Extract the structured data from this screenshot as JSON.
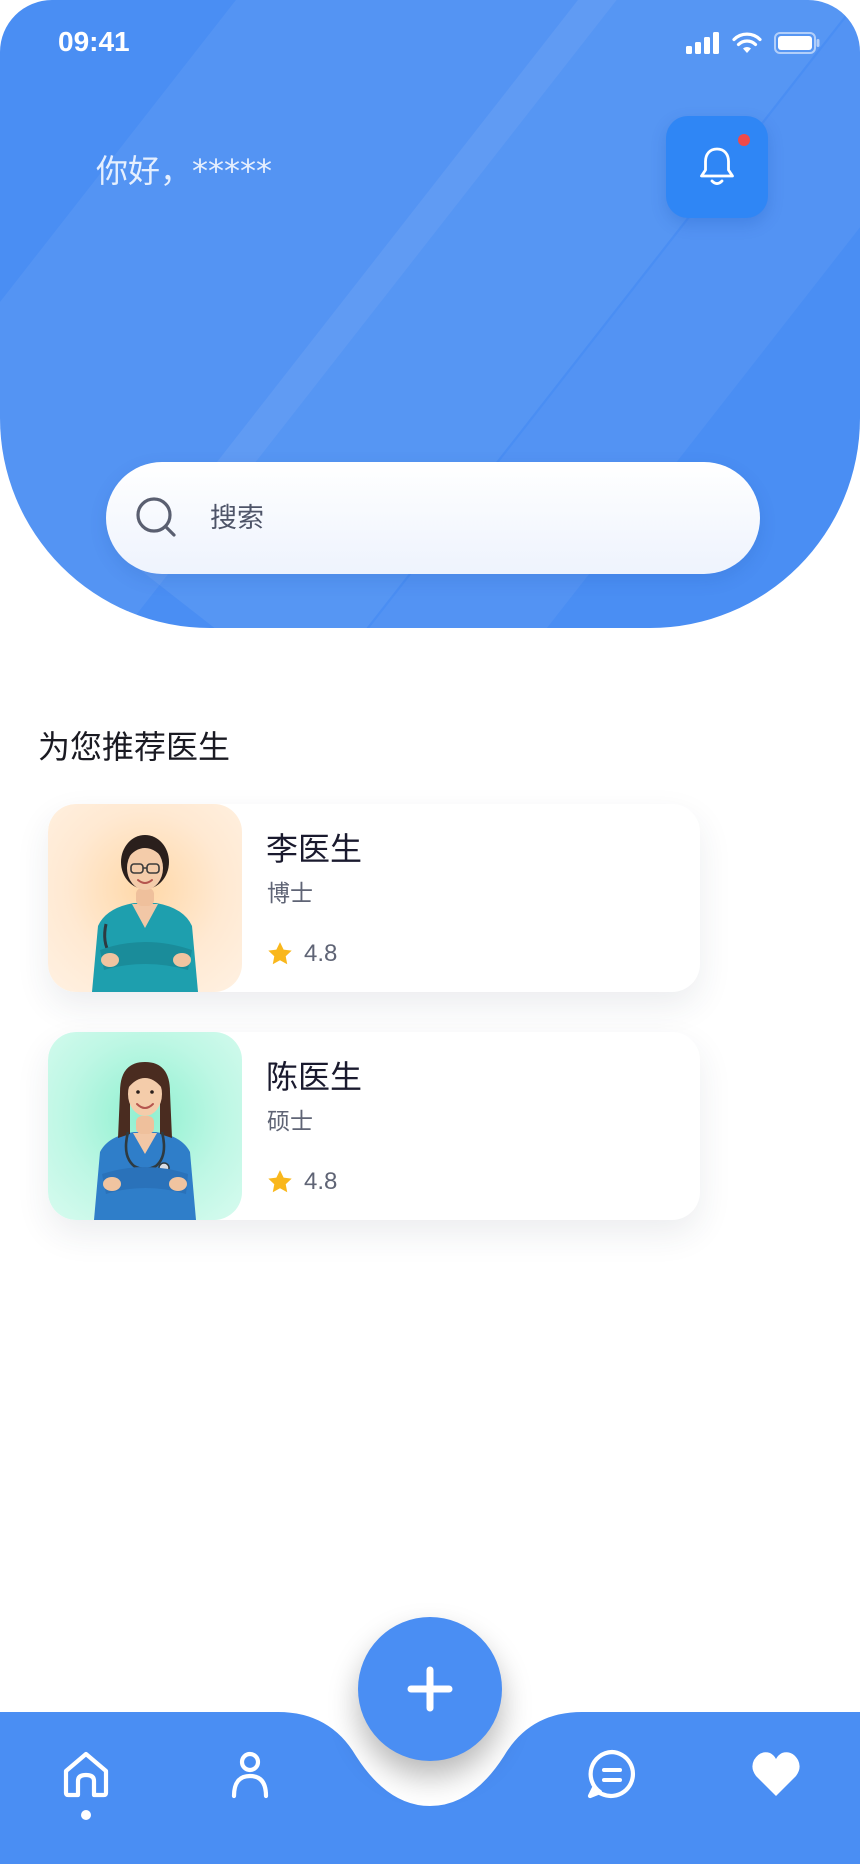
{
  "status_bar": {
    "time": "09:41",
    "icons": [
      "signal-icon",
      "wifi-icon",
      "battery-icon"
    ]
  },
  "header": {
    "greeting": "你好，*****",
    "bell_icon": "bell-icon",
    "has_notification": true
  },
  "search": {
    "placeholder": "搜索",
    "icon": "search-icon"
  },
  "section": {
    "title": "为您推荐医生"
  },
  "doctors": [
    {
      "name": "李医生",
      "degree": "博士",
      "rating": "4.8",
      "photo_bg": "#FFE4C8"
    },
    {
      "name": "陈医生",
      "degree": "硕士",
      "rating": "4.8",
      "photo_bg": "#C6F6E6"
    }
  ],
  "bottom_nav": {
    "items": [
      "home-icon",
      "profile-icon",
      "add-icon",
      "chat-icon",
      "heart-icon"
    ],
    "active": "home-icon"
  },
  "colors": {
    "primary": "#4A8EF3",
    "bell_bg": "#2F86F5",
    "notification": "#F04A4A",
    "star": "#F9B71C"
  }
}
